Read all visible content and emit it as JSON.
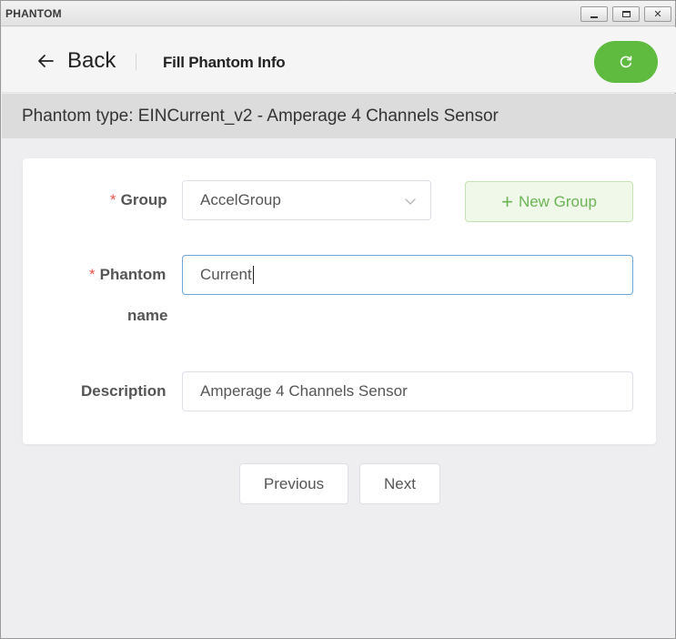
{
  "window": {
    "title": "PHANTOM",
    "controls": {
      "minimize": "minimize",
      "maximize": "maximize",
      "close": "✕"
    }
  },
  "header": {
    "back_label": "Back",
    "page_title": "Fill Phantom Info",
    "refresh_icon": "refresh-icon",
    "accent_color": "#5ebb3f"
  },
  "phantom_type": "Phantom type: EINCurrent_v2 - Amperage 4 Channels Sensor",
  "form": {
    "required_mark": "*",
    "group": {
      "label": "Group",
      "value": "AccelGroup",
      "new_group_label": "New Group"
    },
    "phantom_name": {
      "label_line1": "Phantom",
      "label_line2": "name",
      "value": "Current"
    },
    "description": {
      "label": "Description",
      "value": "Amperage 4 Channels Sensor"
    }
  },
  "footer": {
    "previous_label": "Previous",
    "next_label": "Next"
  }
}
